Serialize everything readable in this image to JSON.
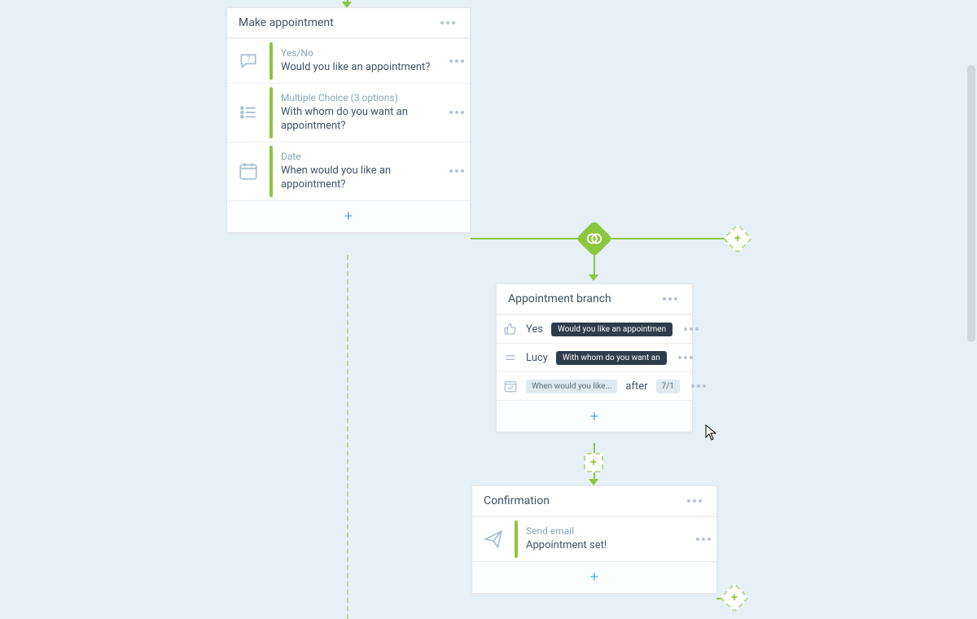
{
  "make_appointment": {
    "title": "Make appointment",
    "q1": {
      "type": "Yes/No",
      "text": "Would you like an appointment?"
    },
    "q2": {
      "type": "Multiple Choice (3 options)",
      "text": "With whom do you want an appointment?"
    },
    "q3": {
      "type": "Date",
      "text": "When would you like an appointment?"
    }
  },
  "appointment_branch": {
    "title": "Appointment branch",
    "r1": {
      "label": "Yes",
      "tag": "Would you like an appointmen"
    },
    "r2": {
      "label": "Lucy",
      "tag": "With whom do you want an"
    },
    "r3": {
      "tag_light": "When would you like...",
      "keyword": "after",
      "date_tag": "7/1"
    }
  },
  "confirmation": {
    "title": "Confirmation",
    "step": {
      "type": "Send email",
      "text": "Appointment set!"
    }
  }
}
